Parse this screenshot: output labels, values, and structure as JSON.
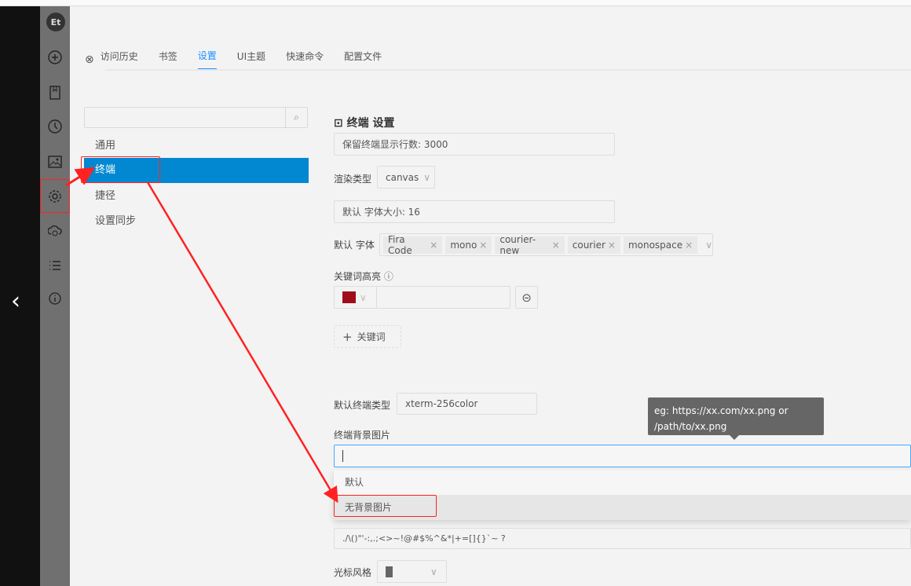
{
  "sidebar_icons": [
    "logo",
    "plus-icon",
    "bookmark-icon",
    "clock-icon",
    "image-icon",
    "gear-icon",
    "cloud-sync-icon",
    "list-icon",
    "info-icon"
  ],
  "logo_text": "Et",
  "tabs": [
    {
      "label": "访问历史"
    },
    {
      "label": "书签"
    },
    {
      "label": "设置",
      "active": true
    },
    {
      "label": "UI主题"
    },
    {
      "label": "快速命令"
    },
    {
      "label": "配置文件"
    }
  ],
  "nav": {
    "search_value": "",
    "items": [
      {
        "label": "通用"
      },
      {
        "label": "终端",
        "active": true
      },
      {
        "label": "捷径"
      },
      {
        "label": "设置同步"
      }
    ]
  },
  "terminal": {
    "title": "终端 设置",
    "scrollback": "保留终端显示行数: 3000",
    "render_label": "渲染类型",
    "render_value": "canvas",
    "font_size": "默认 字体大小: 16",
    "font_label": "默认 字体",
    "fonts": [
      "Fira Code",
      "mono",
      "courier-new",
      "courier",
      "monospace"
    ],
    "keyword_label": "关键词高亮",
    "keyword_color": "#a00d1a",
    "add_keyword": "关键词",
    "term_type_label": "默认终端类型",
    "term_type_value": "xterm-256color",
    "bg_label": "终端背景图片",
    "bg_value": "",
    "bg_tooltip_line1": "eg: https://xx.com/xx.png or",
    "bg_tooltip_line2": "/path/to/xx.png",
    "bg_options": [
      "默认",
      "无背景图片"
    ],
    "word_separator": "./\\()\"'-:,.;<>~!@#$%^&*|+=[]{}`~ ?",
    "cursor_label": "光标风格"
  },
  "colors": {
    "accent": "#1890ff",
    "nav_active": "#0288d1",
    "annotation": "#ff2222"
  }
}
